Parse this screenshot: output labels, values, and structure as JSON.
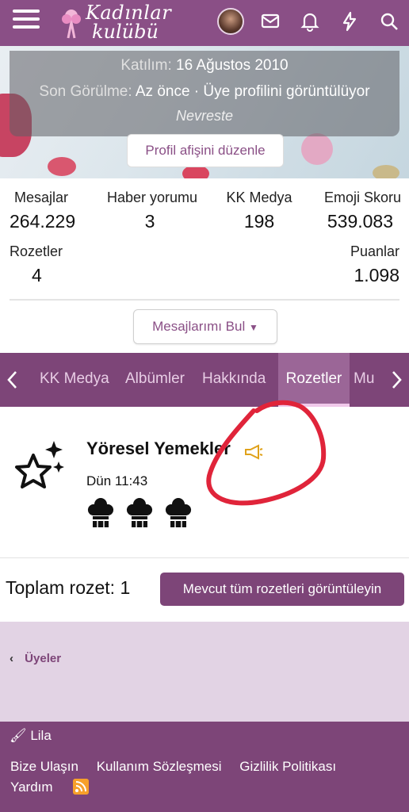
{
  "header": {
    "logo_line1": "Kadınlar",
    "logo_line2": "kulübü",
    "icons": [
      "menu-icon",
      "avatar",
      "mail-icon",
      "bell-icon",
      "bolt-icon",
      "search-icon"
    ]
  },
  "profile": {
    "joined_label": "Katılım:",
    "joined_value": "16 Ağustos 2010",
    "last_seen_label": "Son Görülme:",
    "last_seen_value": "Az önce · Üye profilini görüntülüyor",
    "username": "Nevreste",
    "edit_banner": "Profil afişini düzenle"
  },
  "stats": [
    {
      "label": "Mesajlar",
      "value": "264.229"
    },
    {
      "label": "Haber yorumu",
      "value": "3"
    },
    {
      "label": "KK Medya",
      "value": "198"
    },
    {
      "label": "Emoji Skoru",
      "value": "539.083"
    },
    {
      "label": "Rozetler",
      "value": "4"
    },
    {
      "label": "Puanlar",
      "value": "1.098"
    }
  ],
  "find_posts": "Mesajlarımı Bul",
  "tabs": [
    "KK Medya",
    "Albümler",
    "Hakkında",
    "Rozetler",
    "Mu"
  ],
  "badge": {
    "title": "Yöresel Yemekler",
    "date": "Dün 11:43"
  },
  "total_label": "Toplam rozet: 1",
  "view_all": "Mevcut tüm rozetleri görüntüleyin",
  "breadcrumb": "Üyeler",
  "footer": {
    "style": "Lila",
    "links": [
      "Bize Ulaşın",
      "Kullanım Sözleşmesi",
      "Gizlilik Politikası"
    ],
    "help": "Yardım"
  },
  "colors": {
    "brand": "#8a4f86",
    "tabs": "#7d4578",
    "annotation": "#e0243a"
  }
}
